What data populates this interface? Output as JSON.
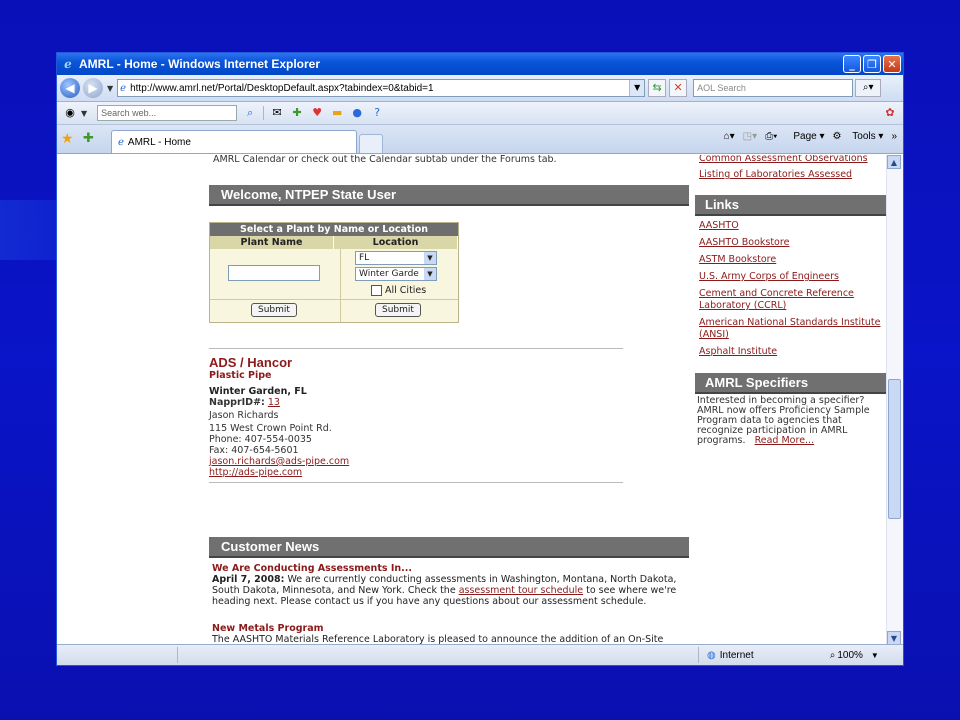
{
  "window": {
    "title": "AMRL - Home - Windows Internet Explorer",
    "controls": {
      "minimize": "_",
      "maximize": "❐",
      "close": "✕"
    }
  },
  "address_bar": {
    "url": "http://www.amrl.net/Portal/DesktopDefault.aspx?tabindex=0&tabid=1",
    "search_placeholder": "AOL Search"
  },
  "toolbar": {
    "search_placeholder": "Search web..."
  },
  "tabs": [
    {
      "label": "AMRL - Home"
    }
  ],
  "command_bar": {
    "page": "Page",
    "tools": "Tools"
  },
  "page": {
    "calendar_note": "AMRL Calendar or check out the Calendar subtab under the Forums tab.",
    "welcome_header": "Welcome, NTPEP State User",
    "plant_form": {
      "title": "Select a Plant by Name or Location",
      "col_name": "Plant Name",
      "col_location": "Location",
      "state_value": "FL",
      "city_value": "Winter Garde",
      "all_cities_label": "All Cities",
      "submit_label": "Submit",
      "submit_label_2": "Submit"
    },
    "company": {
      "name": "ADS / Hancor",
      "type": "Plastic Pipe",
      "location": "Winter Garden, FL",
      "nappr_label": "NapprID#:",
      "nappr_id": "13",
      "contact": "Jason  Richards",
      "address": "115 West Crown Point Rd.",
      "phone": "Phone: 407-554-0035",
      "fax": "Fax: 407-654-5601",
      "email": "jason.richards@ads-pipe.com",
      "website": "http://ads-pipe.com"
    },
    "news": {
      "header": "Customer News",
      "item1_title": "We Are Conducting Assessments In...",
      "item1_date": "April 7, 2008:",
      "item1_text_a": " We are currently conducting assessments in Washington, Montana, North Dakota, South Dakota, Minnesota, and New York. Check the ",
      "item1_link": "assessment tour schedule",
      "item1_text_b": " to see where we're heading next. Please contact us if you have any questions about our assessment schedule.",
      "item2_title": "New Metals Program",
      "item2_text": "The AASHTO Materials Reference Laboratory is pleased to announce the addition of an On-Site"
    },
    "sidebar": {
      "top_links": [
        "Common Assessment Observations",
        "Listing of Laboratories Assessed"
      ],
      "links_header": "Links",
      "links": [
        "AASHTO",
        "AASHTO Bookstore",
        "ASTM Bookstore",
        "U.S. Army Corps of Engineers",
        "Cement and Concrete Reference Laboratory (CCRL)",
        "American National Standards Institute (ANSI)",
        "Asphalt Institute"
      ],
      "specifiers_header": "AMRL Specifiers",
      "specifiers_text": "Interested in becoming a specifier? AMRL now offers Proficiency Sample Program data to agencies that recognize participation in AMRL programs.",
      "read_more": "Read More..."
    }
  },
  "status_bar": {
    "zone": "Internet",
    "zoom": "100%"
  },
  "colors": {
    "slide_background": "#0a12c0",
    "link": "#8b1a1a",
    "section_header": "#707070",
    "form_background": "#f8f6de"
  }
}
